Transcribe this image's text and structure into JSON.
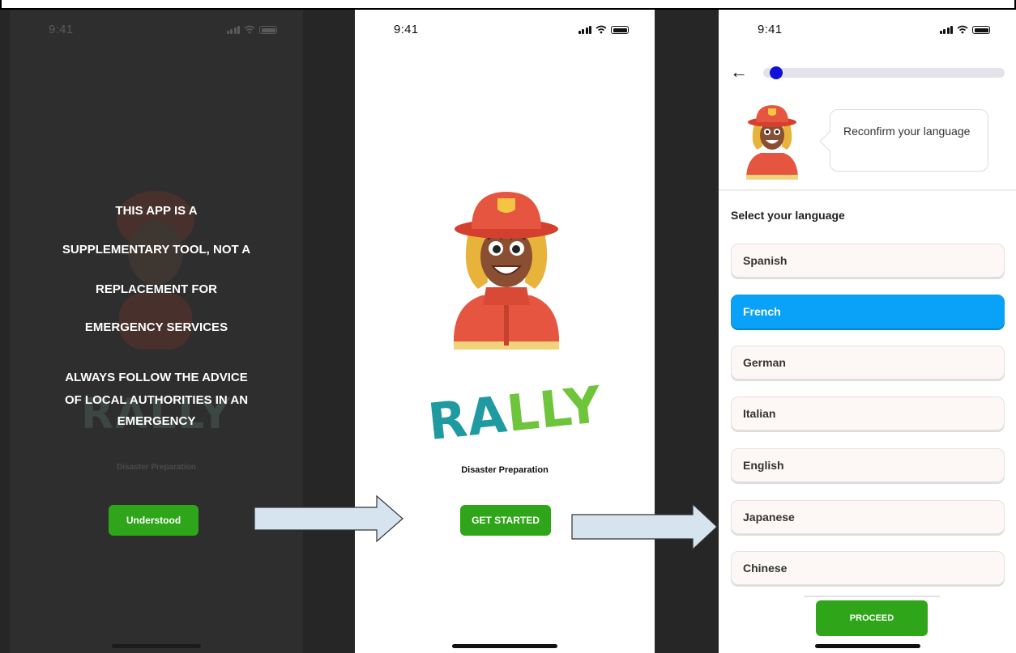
{
  "screens": {
    "disclaimer": {
      "time": "9:41",
      "lines": [
        "THIS APP IS A",
        "SUPPLEMENTARY TOOL, NOT A",
        "REPLACEMENT FOR",
        "EMERGENCY SERVICES",
        "ALWAYS FOLLOW THE ADVICE",
        "OF LOCAL AUTHORITIES IN AN",
        "EMERGENCY"
      ],
      "background_logo": "RALLY",
      "background_tagline": "Disaster Preparation",
      "button_label": "Understood"
    },
    "welcome": {
      "time": "9:41",
      "logo": "RALLY",
      "tagline": "Disaster Preparation",
      "button_label": "GET STARTED"
    },
    "language": {
      "time": "9:41",
      "progress_fraction": 0.03,
      "bubble_text": "Reconfirm your language",
      "section_title": "Select your language",
      "languages": [
        "Spanish",
        "French",
        "German",
        "Italian",
        "English",
        "Japanese",
        "Chinese"
      ],
      "selected_language": "French",
      "button_label": "PROCEED"
    }
  },
  "colors": {
    "accent_green": "#2fa51a",
    "selected_blue": "#0aa2f8",
    "progress_dot": "#1212d6",
    "arrow_fill": "#d6e4f0",
    "logo_teal": "#1f9aa0",
    "logo_green": "#6ec43a"
  }
}
